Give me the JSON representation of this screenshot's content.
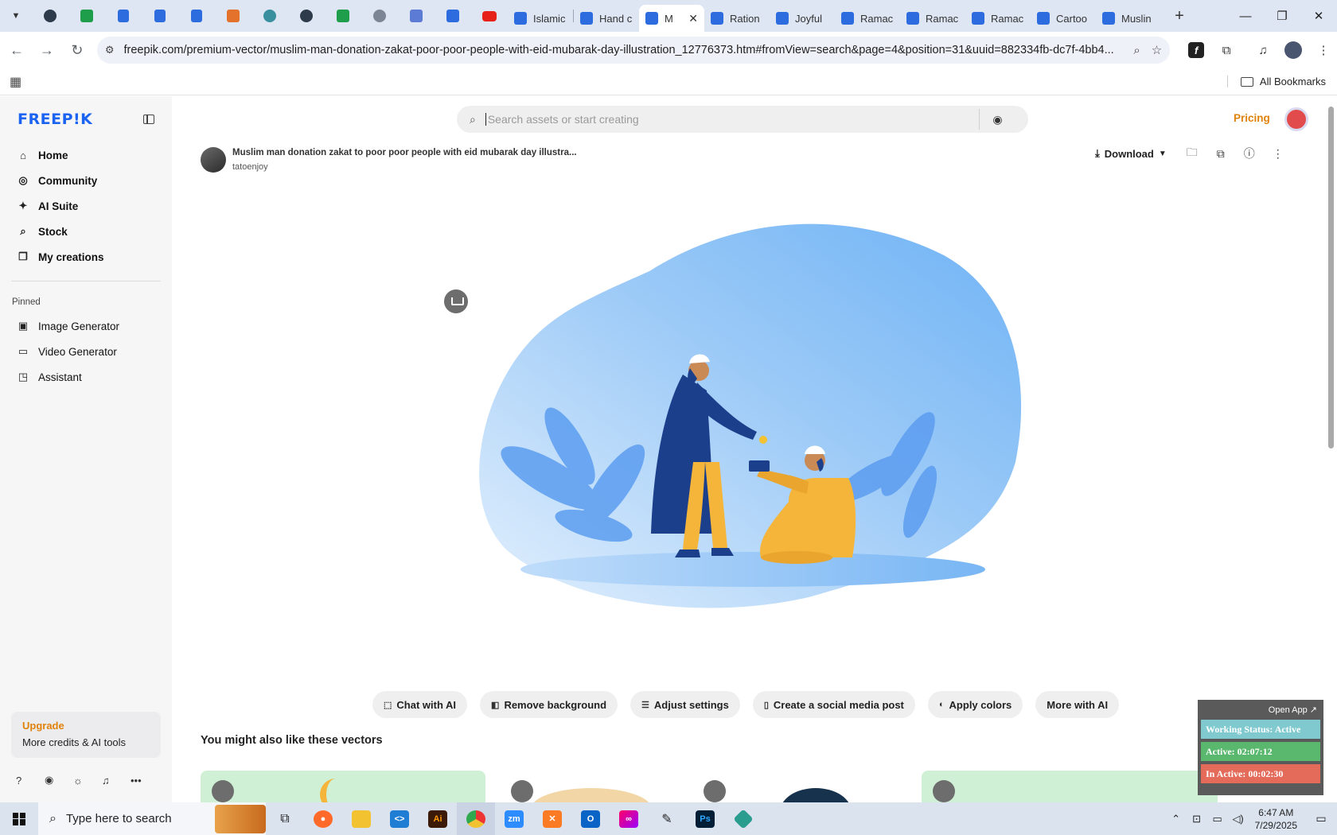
{
  "browser": {
    "tabs": [
      {
        "label": "Islamic",
        "icon": "docs-icon"
      },
      {
        "label": "Hand c",
        "icon": "docs-icon"
      },
      {
        "label": "M",
        "icon": "docs-icon",
        "active": true
      },
      {
        "label": "Ration",
        "icon": "docs-icon"
      },
      {
        "label": "Joyful",
        "icon": "docs-icon"
      },
      {
        "label": "Ramac",
        "icon": "docs-icon"
      },
      {
        "label": "Ramac",
        "icon": "docs-icon"
      },
      {
        "label": "Ramac",
        "icon": "docs-icon"
      },
      {
        "label": "Cartoo",
        "icon": "docs-icon"
      },
      {
        "label": "Muslin",
        "icon": "docs-icon"
      }
    ],
    "url": "freepik.com/premium-vector/muslim-man-donation-zakat-poor-poor-people-with-eid-mubarak-day-illustration_12776373.htm#fromView=search&page=4&position=31&uuid=882334fb-dc7f-4bb4...",
    "all_bookmarks": "All Bookmarks"
  },
  "sidebar": {
    "logo": "FREEP!K",
    "nav": [
      {
        "label": "Home",
        "icon": "⌂"
      },
      {
        "label": "Community",
        "icon": "◎"
      },
      {
        "label": "AI Suite",
        "icon": "✦"
      },
      {
        "label": "Stock",
        "icon": "⌕"
      },
      {
        "label": "My creations",
        "icon": "❐"
      }
    ],
    "pinned_title": "Pinned",
    "pinned": [
      {
        "label": "Image Generator",
        "icon": "▣"
      },
      {
        "label": "Video Generator",
        "icon": "▭"
      },
      {
        "label": "Assistant",
        "icon": "◳"
      }
    ],
    "upgrade": {
      "title": "Upgrade",
      "subtitle": "More credits & AI tools"
    }
  },
  "header": {
    "search_placeholder": "Search assets or start creating",
    "pricing": "Pricing"
  },
  "asset": {
    "title": "Muslim man donation zakat to poor poor people with eid mubarak day illustra...",
    "author": "tatoenjoy",
    "download_label": "Download"
  },
  "ai_tools": [
    {
      "label": "Chat with AI",
      "icon": "⬚"
    },
    {
      "label": "Remove background",
      "icon": "◧"
    },
    {
      "label": "Adjust settings",
      "icon": "☰"
    },
    {
      "label": "Create a social media post",
      "icon": "▯"
    },
    {
      "label": "Apply colors",
      "icon": "◐"
    },
    {
      "label": "More with AI",
      "icon": ""
    }
  ],
  "related_title": "You might also like these vectors",
  "taskbar": {
    "search_placeholder": "Type here to search",
    "time": "6:47 AM",
    "date": "7/29/2025"
  },
  "status_widget": {
    "open_app": "Open App ↗",
    "working": "Working Status: Active",
    "active": "Active: 02:07:12",
    "inactive": "In Active: 00:02:30"
  },
  "colors": {
    "brand_blue": "#1b64f2",
    "accent_orange": "#e0820a",
    "blob_blue": "#6fb3f5",
    "figure_yellow": "#f5b43a",
    "figure_navy": "#1c3f8c"
  }
}
